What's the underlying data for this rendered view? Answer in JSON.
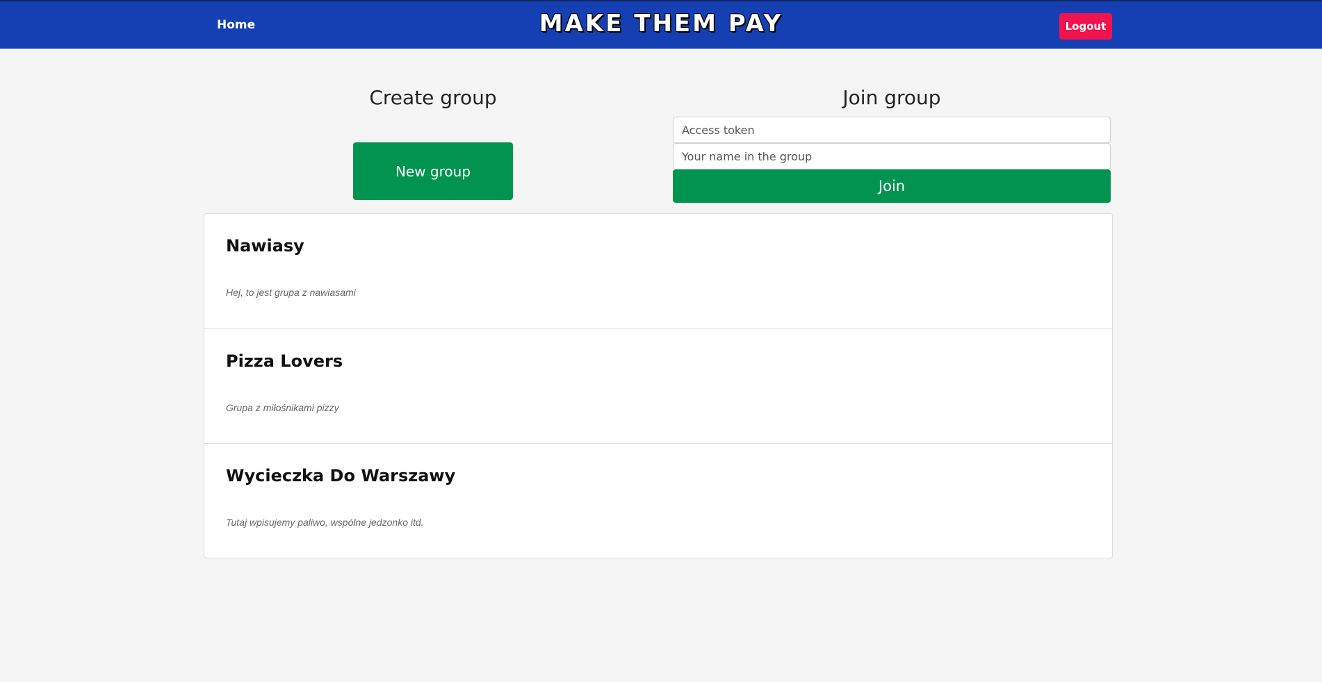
{
  "navbar": {
    "home_label": "Home",
    "brand": "MAKE THEM PAY",
    "logout_label": "Logout"
  },
  "create_group": {
    "title": "Create group",
    "button_label": "New group"
  },
  "join_group": {
    "title": "Join group",
    "token_placeholder": "Access token",
    "name_placeholder": "Your name in the group",
    "button_label": "Join"
  },
  "groups": [
    {
      "name": "Nawiasy",
      "description": "Hej, to jest grupa z nawiasami"
    },
    {
      "name": "Pizza Lovers",
      "description": "Grupa z miłośnikami pizzy"
    },
    {
      "name": "Wycieczka Do Warszawy",
      "description": "Tutaj wpisujemy paliwo, wspólne jedzonko itd."
    }
  ],
  "colors": {
    "navbar": "#1540b4",
    "primary_button": "#009450",
    "logout_button": "#f0134d",
    "background": "#f5f5f5"
  }
}
